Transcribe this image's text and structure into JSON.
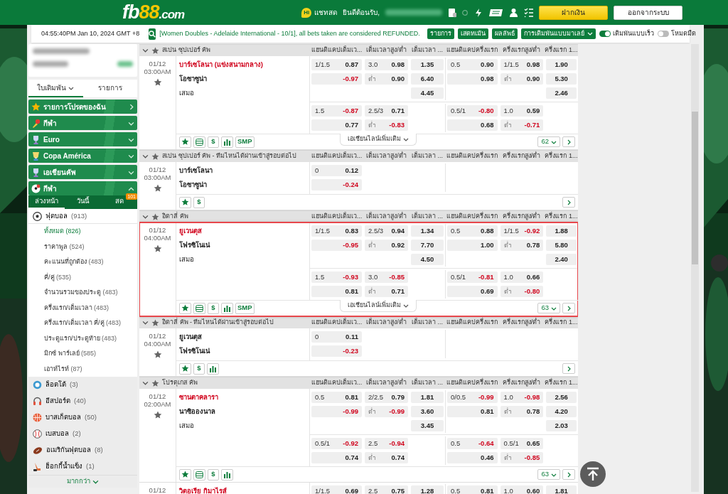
{
  "header": {
    "logo": {
      "main": "fb",
      "accent": "88",
      "suffix": ".com"
    },
    "chat": {
      "badge": "Hi",
      "label": "แชทสด"
    },
    "welcome": "ยินดีต้อนรับ,",
    "buttons": [
      {
        "label": "ฝากเงิน",
        "kind": "primary"
      },
      {
        "label": "ออกจากระบบ",
        "kind": "secondary"
      }
    ]
  },
  "toolbar": {
    "clock": "04:55:40PM Jan 10, 2024 GMT +8",
    "ticker": "[Women Doubles - Adelaide International - 10/1], all bets taken are considered REFUNDED.",
    "buttons": [
      "รายการ",
      "เสตทเม้น",
      "ผลลัพธ์"
    ],
    "odds_type": "การเดิมพันแบบมาเลย์",
    "toggles": [
      {
        "label": "เดิมพันแบบเร็ว",
        "on": true
      },
      {
        "label": "โหมดมืด",
        "on": false
      }
    ]
  },
  "sidebar": {
    "tabs": [
      {
        "label": "ใบเดิมพัน",
        "selected": true
      },
      {
        "label": "รายการ",
        "selected": false
      }
    ],
    "menu": [
      {
        "label": "รายการโปรดของฉัน",
        "kind": "favorites"
      },
      {
        "label": "กีฬา",
        "kind": "torch",
        "expanded": false
      },
      {
        "label": "Euro",
        "kind": "trophy",
        "expanded": false
      },
      {
        "label": "Copa América",
        "kind": "cup",
        "expanded": false
      },
      {
        "label": "เอเชียนคัพ",
        "kind": "trophy",
        "expanded": false
      },
      {
        "label": "กีฬา",
        "kind": "ball",
        "expanded": true
      }
    ],
    "subtabs": [
      {
        "label": "ล่วงหน้า",
        "selected": true
      },
      {
        "label": "วันนี้",
        "selected": false
      },
      {
        "label": "สด",
        "selected": false,
        "badge": "101"
      }
    ],
    "sports": [
      {
        "label": "ฟุตบอล",
        "count": "(913)",
        "kind": "soccer",
        "expanded": true,
        "children": [
          {
            "label": "ทั้งหมด",
            "count": "(826)",
            "selected": true
          },
          {
            "label": "ราคาพูล",
            "count": "(524)",
            "selected": false
          },
          {
            "label": "คะแนนที่ถูกต้อง",
            "count": "(483)",
            "selected": false
          },
          {
            "label": "คี่/คู่",
            "count": "(535)",
            "selected": false
          },
          {
            "label": "จำนวนรวมของประตู",
            "count": "(483)",
            "selected": false
          },
          {
            "label": "ครึ่งแรก/เต็มเวลา",
            "count": "(483)",
            "selected": false
          },
          {
            "label": "ครึ่งแรก/เต็มเวลา คี่/คู่",
            "count": "(483)",
            "selected": false
          },
          {
            "label": "ประตูแรก/ประตูท้าย",
            "count": "(483)",
            "selected": false
          },
          {
            "label": "มิกซ์ พาร์เลย์",
            "count": "(585)",
            "selected": false
          },
          {
            "label": "เอาท์ไรท์",
            "count": "(87)",
            "selected": false
          }
        ]
      },
      {
        "label": "ล็อตโต้",
        "count": "(3)",
        "kind": "lotto"
      },
      {
        "label": "อีสปอร์ต",
        "count": "(40)",
        "kind": "esports"
      },
      {
        "label": "บาสเก็ตบอล",
        "count": "(50)",
        "kind": "basketball"
      },
      {
        "label": "เบสบอล",
        "count": "(2)",
        "kind": "baseball"
      },
      {
        "label": "อเมริกันฟุตบอล",
        "count": "(8)",
        "kind": "football"
      },
      {
        "label": "ฮ็อกกี้น้ำแข็ง",
        "count": "(1)",
        "kind": "hockey"
      }
    ],
    "more": "มากกว่า"
  },
  "leagues": [
    {
      "name": "สเปน ซุปเปอร์ คัพ",
      "expanded": true,
      "columns": [
        "แฮนดิแคปเต็มเว...",
        "เต็มเวลาสูง/ต่ำ",
        "เต็มเวลา ...",
        "แฮนดิแคปครึ่งแรก",
        "ครึ่งแรกสูง/ต่ำ",
        "ครึ่งแรก 1..."
      ],
      "matches": [
        {
          "date": "01/12",
          "time": "03:00AM",
          "favorite": false,
          "highlighted": false,
          "home": {
            "name": "บาร์เซโลนา (แข่งสนามกลาง)",
            "favored": true
          },
          "away": {
            "name": "โอซาซูน่า",
            "favored": false
          },
          "draw": "เสมอ",
          "lines": [
            {
              "hdp": [
                {
                  "line": "1/1.5",
                  "odds": "0.87"
                },
                {
                  "odds": "-0.97"
                }
              ],
              "ou": [
                {
                  "line": "3.0",
                  "odds": "0.98"
                },
                {
                  "line": "ต่ำ",
                  "odds": "0.90"
                }
              ],
              "x12": [
                "1.35",
                "6.40",
                "4.45"
              ],
              "fh_hdp": [
                {
                  "line": "0.5",
                  "odds": "0.90"
                },
                {
                  "odds": "0.98"
                }
              ],
              "fh_ou": [
                {
                  "line": "1/1.5",
                  "odds": "0.98"
                },
                {
                  "line": "ต่ำ",
                  "odds": "0.90"
                }
              ],
              "fh_x12": [
                "1.90",
                "5.30",
                "2.46"
              ]
            },
            {
              "hdp": [
                {
                  "line": "1.5",
                  "odds": "-0.87"
                },
                {
                  "odds": "0.77"
                }
              ],
              "ou": [
                {
                  "line": "2.5/3",
                  "odds": "0.71"
                },
                {
                  "line": "ต่ำ",
                  "odds": "-0.83"
                }
              ],
              "fh_hdp": [
                {
                  "line": "0.5/1",
                  "odds": "-0.80"
                },
                {
                  "odds": "0.68"
                }
              ],
              "fh_ou": [
                {
                  "line": "1.0",
                  "odds": "0.59"
                },
                {
                  "line": "ต่ำ",
                  "odds": "-0.71"
                }
              ]
            }
          ],
          "tools": [
            {
              "kind": "star"
            },
            {
              "kind": "list"
            },
            {
              "kind": "text",
              "label": "$"
            },
            {
              "kind": "stats"
            },
            {
              "kind": "text",
              "label": "SMP"
            }
          ],
          "more_lines": "เอเชียนไลน์เพิ่มเติม",
          "count": "62"
        }
      ]
    },
    {
      "name": "สเปน ซุปเปอร์ คัพ - ทีมไหนได้ผ่านเข้าสู่รอบต่อไป",
      "expanded": true,
      "columns": [
        "แฮนดิแคปเต็มเว...",
        "เต็มเวลาสูง/ต่ำ",
        "เต็มเวลา ...",
        "แฮนดิแคปครึ่งแรก",
        "ครึ่งแรกสูง/ต่ำ",
        "ครึ่งแรก 1..."
      ],
      "matches": [
        {
          "date": "01/12",
          "time": "03:00AM",
          "favorite": false,
          "highlighted": false,
          "home": {
            "name": "บาร์เซโลนา",
            "favored": false
          },
          "away": {
            "name": "โอซาซูน่า",
            "favored": false
          },
          "lines": [
            {
              "hdp": [
                {
                  "line": "0",
                  "odds": "0.12"
                },
                {
                  "odds": "-0.24"
                }
              ]
            }
          ],
          "tools": [
            {
              "kind": "star"
            },
            {
              "kind": "text",
              "label": "$"
            }
          ]
        }
      ]
    },
    {
      "name": "อิตาลี่ คัพ",
      "expanded": true,
      "columns": [
        "แฮนดิแคปเต็มเว...",
        "เต็มเวลาสูง/ต่ำ",
        "เต็มเวลา ...",
        "แฮนดิแคปครึ่งแรก",
        "ครึ่งแรกสูง/ต่ำ",
        "ครึ่งแรก 1..."
      ],
      "matches": [
        {
          "date": "01/12",
          "time": "04:00AM",
          "favorite": false,
          "highlighted": true,
          "home": {
            "name": "ยูเวนตุส",
            "favored": true
          },
          "away": {
            "name": "โฟรซิโนเน่",
            "favored": false
          },
          "draw": "เสมอ",
          "lines": [
            {
              "hdp": [
                {
                  "line": "1/1.5",
                  "odds": "0.83"
                },
                {
                  "odds": "-0.95"
                }
              ],
              "ou": [
                {
                  "line": "2.5/3",
                  "odds": "0.94"
                },
                {
                  "line": "ต่ำ",
                  "odds": "0.92"
                }
              ],
              "x12": [
                "1.34",
                "7.70",
                "4.50"
              ],
              "fh_hdp": [
                {
                  "line": "0.5",
                  "odds": "0.88"
                },
                {
                  "odds": "1.00"
                }
              ],
              "fh_ou": [
                {
                  "line": "1/1.5",
                  "odds": "-0.92"
                },
                {
                  "line": "ต่ำ",
                  "odds": "0.78"
                }
              ],
              "fh_x12": [
                "1.88",
                "5.80",
                "2.40"
              ]
            },
            {
              "hdp": [
                {
                  "line": "1.5",
                  "odds": "-0.93"
                },
                {
                  "odds": "0.81"
                }
              ],
              "ou": [
                {
                  "line": "3.0",
                  "odds": "-0.85"
                },
                {
                  "line": "ต่ำ",
                  "odds": "0.71"
                }
              ],
              "fh_hdp": [
                {
                  "line": "0.5/1",
                  "odds": "-0.81"
                },
                {
                  "odds": "0.69"
                }
              ],
              "fh_ou": [
                {
                  "line": "1.0",
                  "odds": "0.66"
                },
                {
                  "line": "ต่ำ",
                  "odds": "-0.80"
                }
              ]
            }
          ],
          "tools": [
            {
              "kind": "star"
            },
            {
              "kind": "list"
            },
            {
              "kind": "text",
              "label": "$"
            },
            {
              "kind": "stats"
            },
            {
              "kind": "text",
              "label": "SMP"
            }
          ],
          "more_lines": "เอเชียนไลน์เพิ่มเติม",
          "count": "63"
        }
      ]
    },
    {
      "name": "อิตาลี่ คัพ - ทีมไหนได้ผ่านเข้าสู่รอบต่อไป",
      "expanded": true,
      "columns": [
        "แฮนดิแคปเต็มเว...",
        "เต็มเวลาสูง/ต่ำ",
        "เต็มเวลา ...",
        "แฮนดิแคปครึ่งแรก",
        "ครึ่งแรกสูง/ต่ำ",
        "ครึ่งแรก 1..."
      ],
      "matches": [
        {
          "date": "01/12",
          "time": "04:00AM",
          "favorite": false,
          "highlighted": false,
          "home": {
            "name": "ยูเวนตุส",
            "favored": false
          },
          "away": {
            "name": "โฟรซิโนเน่",
            "favored": false
          },
          "lines": [
            {
              "hdp": [
                {
                  "line": "0",
                  "odds": "0.11"
                },
                {
                  "odds": "-0.23"
                }
              ]
            }
          ],
          "tools": [
            {
              "kind": "star"
            },
            {
              "kind": "text",
              "label": "$"
            },
            {
              "kind": "stats"
            }
          ]
        }
      ]
    },
    {
      "name": "โปรตุเกส คัพ",
      "expanded": true,
      "columns": [
        "แฮนดิแคปเต็มเว...",
        "เต็มเวลาสูง/ต่ำ",
        "เต็มเวลา ...",
        "แฮนดิแคปครึ่งแรก",
        "ครึ่งแรกสูง/ต่ำ",
        "ครึ่งแรก 1..."
      ],
      "matches": [
        {
          "date": "01/12",
          "time": "02:00AM",
          "favorite": false,
          "highlighted": false,
          "home": {
            "name": "ซานตาคลารา",
            "favored": true
          },
          "away": {
            "name": "นาซิอองนาล",
            "favored": false
          },
          "draw": "เสมอ",
          "lines": [
            {
              "hdp": [
                {
                  "line": "0.5",
                  "odds": "0.81"
                },
                {
                  "odds": "-0.99"
                }
              ],
              "ou": [
                {
                  "line": "2/2.5",
                  "odds": "0.79"
                },
                {
                  "line": "ต่ำ",
                  "odds": "-0.99"
                }
              ],
              "x12": [
                "1.81",
                "3.60",
                "3.45"
              ],
              "fh_hdp": [
                {
                  "line": "0/0.5",
                  "odds": "-0.99"
                },
                {
                  "odds": "0.81"
                }
              ],
              "fh_ou": [
                {
                  "line": "1.0",
                  "odds": "-0.98"
                },
                {
                  "line": "ต่ำ",
                  "odds": "0.78"
                }
              ],
              "fh_x12": [
                "2.56",
                "4.20",
                "2.03"
              ]
            },
            {
              "hdp": [
                {
                  "line": "0.5/1",
                  "odds": "-0.92"
                },
                {
                  "odds": "0.74"
                }
              ],
              "ou": [
                {
                  "line": "2.5",
                  "odds": "-0.94"
                },
                {
                  "line": "ต่ำ",
                  "odds": "0.74"
                }
              ],
              "fh_hdp": [
                {
                  "line": "0.5",
                  "odds": "-0.64"
                },
                {
                  "odds": "0.46"
                }
              ],
              "fh_ou": [
                {
                  "line": "0.5/1",
                  "odds": "0.65"
                },
                {
                  "line": "ต่ำ",
                  "odds": "-0.85"
                }
              ]
            }
          ],
          "tools": [
            {
              "kind": "star"
            },
            {
              "kind": "list"
            },
            {
              "kind": "text",
              "label": "$"
            },
            {
              "kind": "stats"
            }
          ],
          "count": "63"
        },
        {
          "date": "01/12",
          "home": {
            "name": "วิตอเรีย กิมาไรส์",
            "favored": true
          },
          "lines": [
            {
              "hdp": [
                {
                  "line": "1/1.5",
                  "odds": "0.69"
                }
              ],
              "ou": [
                {
                  "line": "2.5",
                  "odds": "0.75"
                }
              ],
              "x12": [
                "1.28"
              ],
              "fh_hdp": [
                {
                  "line": "0.5",
                  "odds": "0.81"
                }
              ],
              "fh_ou": [
                {
                  "line": "1.0",
                  "odds": "0.60"
                }
              ],
              "fh_x12": [
                "1.81"
              ]
            }
          ]
        }
      ]
    }
  ]
}
